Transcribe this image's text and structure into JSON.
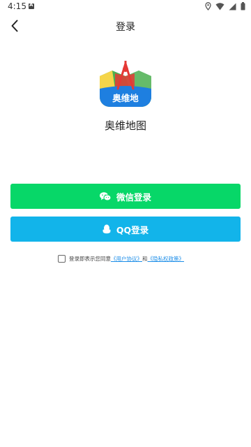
{
  "status_bar": {
    "time": "4:15",
    "notification_icon": "A",
    "icons": [
      "location-icon",
      "wifi-icon",
      "signal-icon",
      "battery-icon"
    ]
  },
  "nav": {
    "title": "登录",
    "back_icon": "chevron-left-icon"
  },
  "app": {
    "logo_text": "奥维地",
    "name": "奥维地图"
  },
  "buttons": {
    "wechat_label": "微信登录",
    "qq_label": "QQ登录"
  },
  "agreement": {
    "checked": false,
    "prefix": "登录即表示您同意",
    "user_agreement": "《用户协议》",
    "conjunction": "和",
    "privacy_policy": "《隐私权政策》"
  },
  "colors": {
    "wechat": "#07d768",
    "qq": "#12b4ea",
    "link": "#1d8ee8"
  }
}
